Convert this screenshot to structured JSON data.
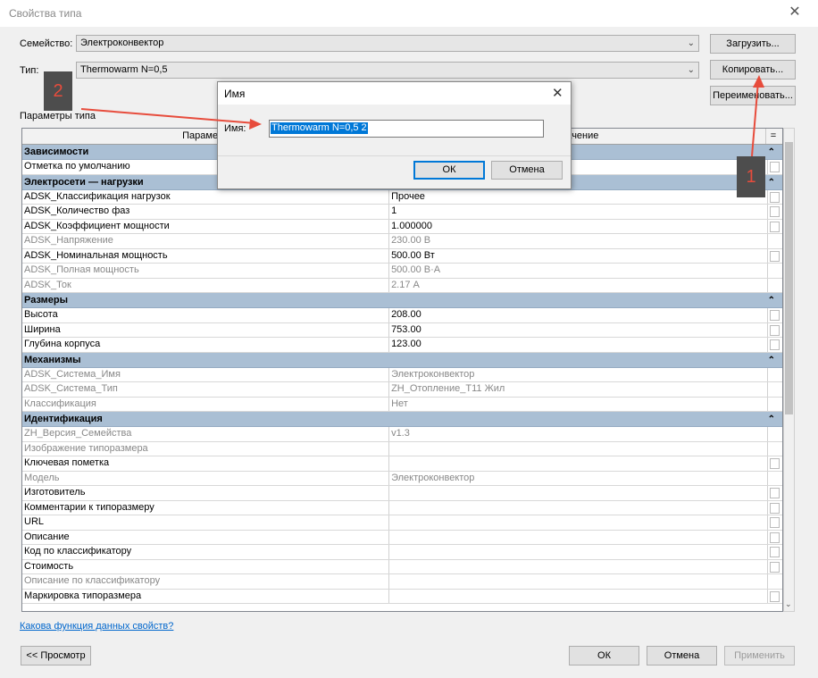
{
  "window": {
    "title": "Свойства типа"
  },
  "family": {
    "label": "Семейство:",
    "value": "Электроконвектор"
  },
  "type": {
    "label": "Тип:",
    "value": "Thermowarm N=0,5"
  },
  "buttons": {
    "load": "Загрузить...",
    "copy": "Копировать...",
    "rename": "Переименовать...",
    "preview": "<< Просмотр",
    "ok": "ОК",
    "cancel": "Отмена",
    "apply": "Применить"
  },
  "params_label": "Параметры типа",
  "grid": {
    "header_param": "Параметр",
    "header_value": "Значение",
    "header_equals": "=",
    "groups": [
      {
        "name": "Зависимости",
        "rows": [
          {
            "param": "Отметка по умолчанию",
            "value": "",
            "disabled": false
          }
        ]
      },
      {
        "name": "Электросети — нагрузки",
        "rows": [
          {
            "param": "ADSK_Классификация нагрузок",
            "value": "Прочее",
            "disabled": false
          },
          {
            "param": "ADSK_Количество фаз",
            "value": "1",
            "disabled": false
          },
          {
            "param": "ADSK_Коэффициент мощности",
            "value": "1.000000",
            "disabled": false
          },
          {
            "param": "ADSK_Напряжение",
            "value": "230.00 В",
            "disabled": true
          },
          {
            "param": "ADSK_Номинальная мощность",
            "value": "500.00 Вт",
            "disabled": false
          },
          {
            "param": "ADSK_Полная мощность",
            "value": "500.00 В·А",
            "disabled": true
          },
          {
            "param": "ADSK_Ток",
            "value": "2.17 А",
            "disabled": true
          }
        ]
      },
      {
        "name": "Размеры",
        "rows": [
          {
            "param": "Высота",
            "value": "208.00",
            "disabled": false
          },
          {
            "param": "Ширина",
            "value": "753.00",
            "disabled": false
          },
          {
            "param": "Глубина корпуса",
            "value": "123.00",
            "disabled": false
          }
        ]
      },
      {
        "name": "Механизмы",
        "rows": [
          {
            "param": "ADSK_Система_Имя",
            "value": "Электроконвектор",
            "disabled": true
          },
          {
            "param": "ADSK_Система_Тип",
            "value": "ZH_Отопление_Т11 Жил",
            "disabled": true
          },
          {
            "param": "Классификация",
            "value": "Нет",
            "disabled": true
          }
        ]
      },
      {
        "name": "Идентификация",
        "rows": [
          {
            "param": "ZH_Версия_Семейства",
            "value": "v1.3",
            "disabled": true
          },
          {
            "param": "Изображение типоразмера",
            "value": "",
            "disabled": true
          },
          {
            "param": "Ключевая пометка",
            "value": "",
            "disabled": false
          },
          {
            "param": "Модель",
            "value": "Электроконвектор",
            "disabled": true
          },
          {
            "param": "Изготовитель",
            "value": "",
            "disabled": false
          },
          {
            "param": "Комментарии к типоразмеру",
            "value": "",
            "disabled": false
          },
          {
            "param": "URL",
            "value": "",
            "disabled": false
          },
          {
            "param": "Описание",
            "value": "",
            "disabled": false
          },
          {
            "param": "Код по классификатору",
            "value": "",
            "disabled": false
          },
          {
            "param": "Стоимость",
            "value": "",
            "disabled": false
          },
          {
            "param": "Описание по классификатору",
            "value": "",
            "disabled": true
          },
          {
            "param": "Маркировка типоразмера",
            "value": "",
            "disabled": false
          }
        ]
      }
    ]
  },
  "link": "Какова функция данных свойств?",
  "dialog": {
    "title": "Имя",
    "label": "Имя:",
    "value": "Thermowarm N=0,5 2",
    "ok": "ОК",
    "cancel": "Отмена"
  },
  "annotations": {
    "marker1": "1",
    "marker2": "2",
    "arrow_color": "#e74c3c"
  },
  "icons": {
    "close": "close-icon",
    "dropdown": "chevron-down-icon",
    "collapse": "double-chevron-up-icon"
  }
}
